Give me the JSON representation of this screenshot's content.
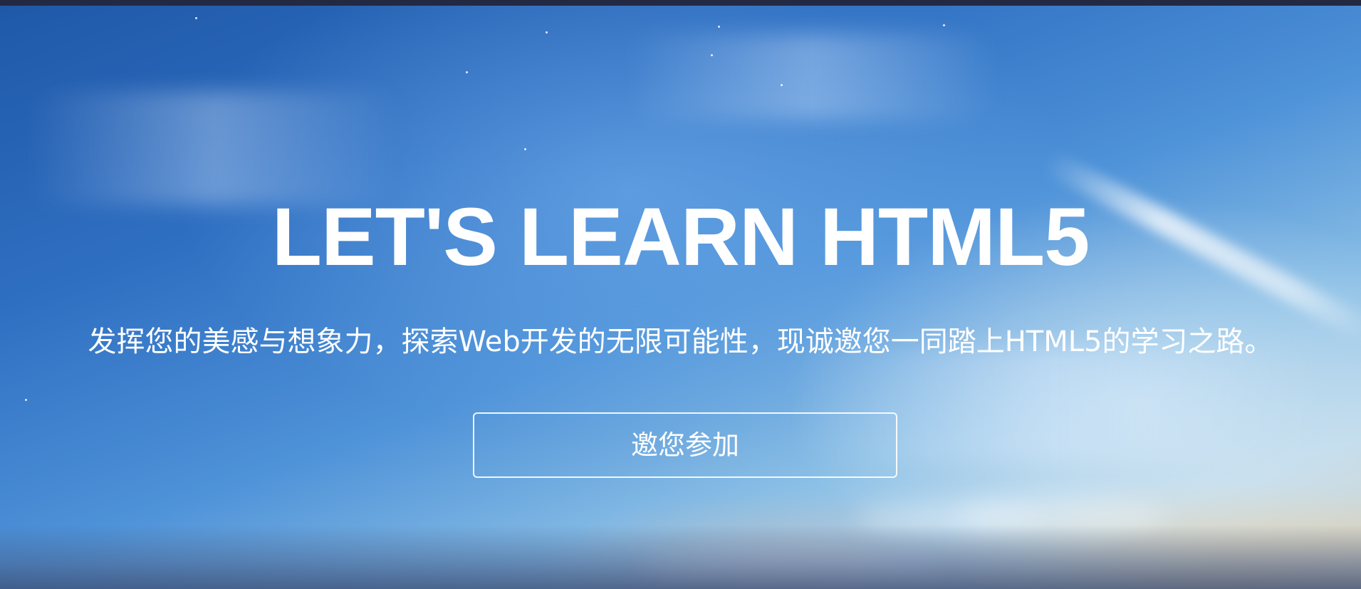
{
  "hero": {
    "headline": "LET'S LEARN HTML5",
    "subtitle": "发挥您的美感与想象力，探索Web开发的无限可能性，现诚邀您一同踏上HTML5的学习之路。",
    "cta_label": "邀您参加"
  },
  "colors": {
    "top_bar": "#232943",
    "sky_top": "#1f58a8",
    "sky_bottom": "#d9d2c0",
    "text": "#ffffff"
  }
}
